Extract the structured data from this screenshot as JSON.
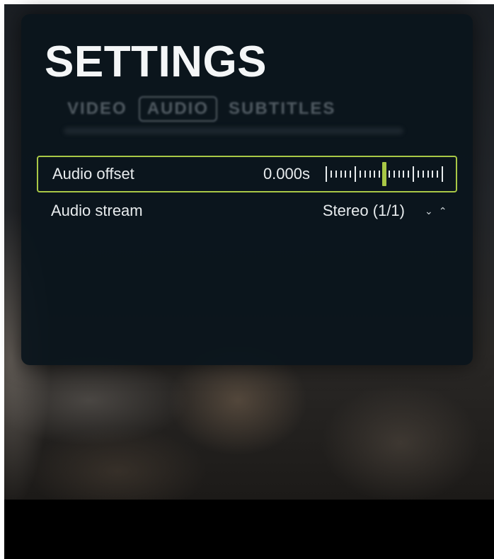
{
  "settings": {
    "title": "SETTINGS",
    "tabs": [
      {
        "label": "VIDEO",
        "active": false
      },
      {
        "label": "AUDIO",
        "active": true
      },
      {
        "label": "SUBTITLES",
        "active": false
      }
    ],
    "rows": {
      "audio_offset": {
        "label": "Audio offset",
        "value": "0.000s",
        "slider_level": 0.5
      },
      "audio_stream": {
        "label": "Audio stream",
        "value": "Stereo (1/1)",
        "down_icon": "chevron-down-icon",
        "up_icon": "chevron-up-icon"
      }
    }
  },
  "colors": {
    "accent": "#a9c846",
    "panel_bg": "#0a141c",
    "text": "#e8ecee"
  }
}
